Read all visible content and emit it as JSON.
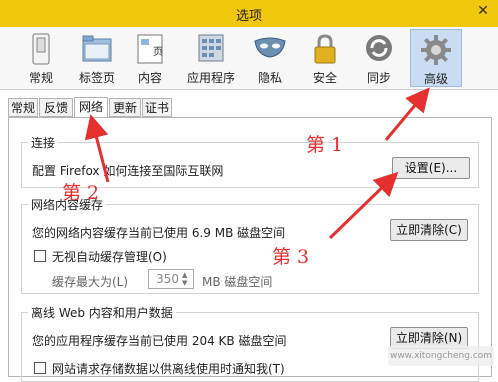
{
  "window": {
    "title": "选项",
    "close_glyph": "✕"
  },
  "toolbar": {
    "items": [
      {
        "label": "常规",
        "icon": "switch-icon"
      },
      {
        "label": "标签页",
        "icon": "folder-tabs-icon"
      },
      {
        "label": "内容",
        "icon": "page-icon"
      },
      {
        "label": "应用程序",
        "icon": "applications-icon"
      },
      {
        "label": "隐私",
        "icon": "mask-icon"
      },
      {
        "label": "安全",
        "icon": "lock-icon"
      },
      {
        "label": "同步",
        "icon": "sync-icon"
      },
      {
        "label": "高级",
        "icon": "gear-icon",
        "active": true
      }
    ]
  },
  "tabs": [
    {
      "label": "常规"
    },
    {
      "label": "反馈"
    },
    {
      "label": "网络",
      "active": true
    },
    {
      "label": "更新"
    },
    {
      "label": "证书"
    }
  ],
  "connection": {
    "legend": "连接",
    "desc": "配置 Firefox 如何连接至国际互联网",
    "button": "设置(E)..."
  },
  "cache": {
    "legend": "网络内容缓存",
    "usage": "您的网络内容缓存当前已使用 6.9 MB 磁盘空间",
    "clear_button": "立即清除(C)",
    "override_label": "无视自动缓存管理(O)",
    "limit_label": "缓存最大为(L)",
    "limit_value": "350",
    "limit_unit": "MB 磁盘空间"
  },
  "offline": {
    "legend": "离线 Web 内容和用户数据",
    "usage": "您的应用程序缓存当前已使用 204 KB 磁盘空间",
    "clear_button": "立即清除(N)",
    "partial_text": "网站请求存储数据以供离线使用时通知我(T)"
  },
  "annotations": {
    "step1": "第  1",
    "step2": "第  2",
    "step3": "第 3",
    "color": "#e53030"
  },
  "watermark": "www.xitongcheng.com"
}
